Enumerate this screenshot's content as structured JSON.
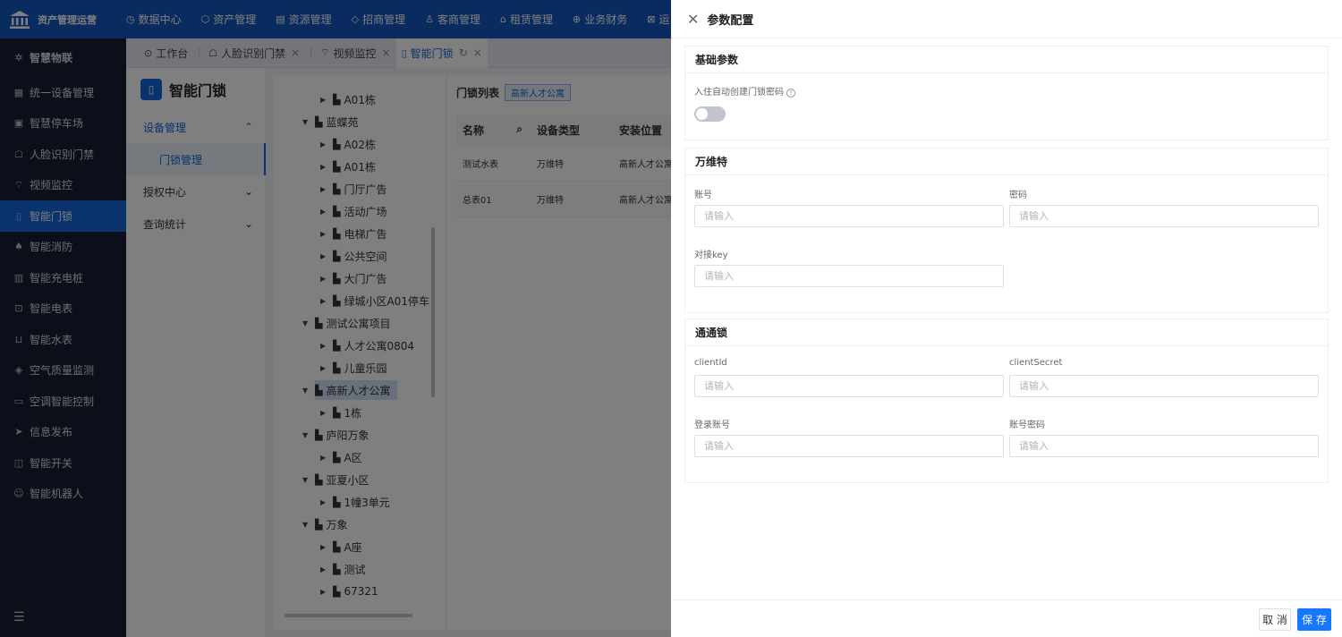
{
  "topbar": {
    "brand": "资产管理运营",
    "nav": [
      {
        "icon": "dashboard-icon",
        "glyph": "◷",
        "label": "数据中心"
      },
      {
        "icon": "cube-icon",
        "glyph": "⬡",
        "label": "资产管理"
      },
      {
        "icon": "document-icon",
        "glyph": "▤",
        "label": "资源管理"
      },
      {
        "icon": "tag-icon",
        "glyph": "◇",
        "label": "招商管理"
      },
      {
        "icon": "users-icon",
        "glyph": "♙",
        "label": "客商管理"
      },
      {
        "icon": "home-icon",
        "glyph": "⌂",
        "label": "租赁管理"
      },
      {
        "icon": "coin-icon",
        "glyph": "⊕",
        "label": "业务财务"
      },
      {
        "icon": "ops-icon",
        "glyph": "⊠",
        "label": "运"
      }
    ]
  },
  "sidebar": {
    "items": [
      {
        "icon": "iot-icon",
        "glyph": "✲",
        "label": "智慧物联",
        "head": true
      },
      {
        "icon": "device-icon",
        "glyph": "▦",
        "label": "统一设备管理"
      },
      {
        "icon": "parking-icon",
        "glyph": "▣",
        "label": "智慧停车场"
      },
      {
        "icon": "face-icon",
        "glyph": "☖",
        "label": "人脸识别门禁"
      },
      {
        "icon": "camera-icon",
        "glyph": "⌔",
        "label": "视频监控"
      },
      {
        "icon": "lock-icon",
        "glyph": "▯",
        "label": "智能门锁",
        "active": true
      },
      {
        "icon": "fire-icon",
        "glyph": "♠",
        "label": "智能消防"
      },
      {
        "icon": "charger-icon",
        "glyph": "▥",
        "label": "智能充电桩"
      },
      {
        "icon": "meter-icon",
        "glyph": "⊡",
        "label": "智能电表"
      },
      {
        "icon": "water-icon",
        "glyph": "⊔",
        "label": "智能水表"
      },
      {
        "icon": "air-icon",
        "glyph": "◈",
        "label": "空气质量监测"
      },
      {
        "icon": "ac-icon",
        "glyph": "▭",
        "label": "空调智能控制"
      },
      {
        "icon": "send-icon",
        "glyph": "➤",
        "label": "信息发布"
      },
      {
        "icon": "switch-icon",
        "glyph": "◫",
        "label": "智能开关"
      },
      {
        "icon": "robot-icon",
        "glyph": "☺",
        "label": "智能机器人"
      }
    ],
    "collapse_icon": "☰"
  },
  "tabs": [
    {
      "icon": "workbench-icon",
      "glyph": "⊙",
      "label": "工作台",
      "closable": false
    },
    {
      "icon": "face-icon",
      "glyph": "☖",
      "label": "人脸识别门禁",
      "closable": true
    },
    {
      "icon": "camera-icon",
      "glyph": "⌔",
      "label": "视频监控",
      "closable": true
    },
    {
      "icon": "lock-icon",
      "glyph": "▯",
      "label": "智能门锁",
      "closable": true,
      "active": true,
      "refresh": "↻"
    }
  ],
  "submenu": {
    "title": "智能门锁",
    "items": [
      {
        "label": "设备管理",
        "chev": "⌃",
        "open": true
      },
      {
        "label": "门锁管理",
        "sub": true
      },
      {
        "label": "授权中心",
        "chev": "⌄"
      },
      {
        "label": "查询统计",
        "chev": "⌄"
      }
    ]
  },
  "tree": [
    {
      "label": "A01栋",
      "level": 2,
      "exp": false
    },
    {
      "label": "蓝蝶苑",
      "level": 1,
      "exp": true
    },
    {
      "label": "A02栋",
      "level": 2,
      "exp": false
    },
    {
      "label": "A01栋",
      "level": 2,
      "exp": false
    },
    {
      "label": "门厅广告",
      "level": 2,
      "exp": false
    },
    {
      "label": "活动广场",
      "level": 2,
      "exp": false
    },
    {
      "label": "电梯广告",
      "level": 2,
      "exp": false
    },
    {
      "label": "公共空间",
      "level": 2,
      "exp": false
    },
    {
      "label": "大门广告",
      "level": 2,
      "exp": false
    },
    {
      "label": "绿城小区A01停车",
      "level": 2,
      "exp": false
    },
    {
      "label": "测试公寓项目",
      "level": 1,
      "exp": true
    },
    {
      "label": "人才公寓0804",
      "level": 2,
      "exp": false
    },
    {
      "label": "儿童乐园",
      "level": 2,
      "exp": false
    },
    {
      "label": "高新人才公寓",
      "level": 1,
      "exp": true,
      "selected": true
    },
    {
      "label": "1栋",
      "level": 2,
      "exp": false
    },
    {
      "label": "庐阳万象",
      "level": 1,
      "exp": true
    },
    {
      "label": "A区",
      "level": 2,
      "exp": false
    },
    {
      "label": "亚夏小区",
      "level": 1,
      "exp": true
    },
    {
      "label": "1幢3单元",
      "level": 2,
      "exp": false
    },
    {
      "label": "万象",
      "level": 1,
      "exp": true
    },
    {
      "label": "A座",
      "level": 2,
      "exp": false
    },
    {
      "label": "测试",
      "level": 2,
      "exp": false
    },
    {
      "label": "67321",
      "level": 2,
      "exp": false
    }
  ],
  "main": {
    "list_title": "门锁列表",
    "tag": "高新人才公寓",
    "columns": [
      "名称",
      "设备类型",
      "安装位置"
    ],
    "rows": [
      [
        "测试水表",
        "万维特",
        "高新人才公寓A"
      ],
      [
        "总表01",
        "万维特",
        "高新人才公寓A"
      ]
    ]
  },
  "drawer": {
    "title": "参数配置",
    "basic": {
      "title": "基础参数",
      "switch_label": "入住自动创建门锁密码",
      "switch_on": false
    },
    "wanweite": {
      "title": "万维特",
      "account_label": "账号",
      "password_label": "密码",
      "key_label": "对接key",
      "placeholder": "请输入"
    },
    "tongtong": {
      "title": "通通锁",
      "client_id_label": "clientId",
      "client_secret_label": "clientSecret",
      "login_label": "登录账号",
      "login_pwd_label": "账号密码",
      "placeholder": "请输入"
    },
    "cancel": "取 消",
    "save": "保 存"
  }
}
